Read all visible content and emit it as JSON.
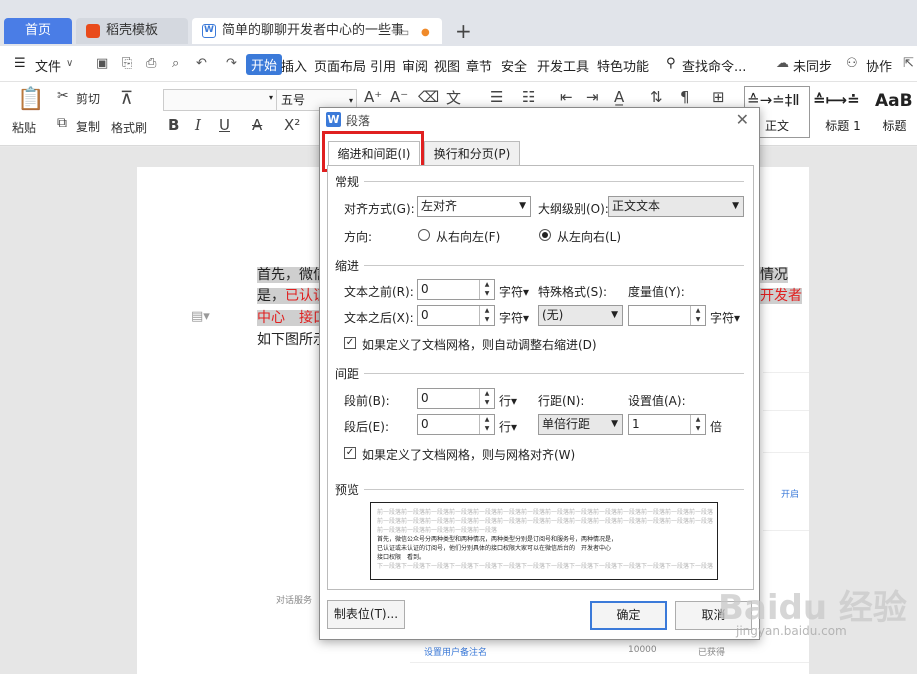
{
  "tabs": {
    "home": "首页",
    "template": "稻壳模板",
    "document": "简单的聊聊开发者中心的一些事",
    "new_tab": "+"
  },
  "menu": {
    "file": "文件",
    "items": [
      "开始",
      "插入",
      "页面布局",
      "引用",
      "审阅",
      "视图",
      "章节",
      "安全",
      "开发工具",
      "特色功能"
    ],
    "search": "查找命令...",
    "sync": "未同步",
    "collab": "协作"
  },
  "ribbon": {
    "paste": "粘贴",
    "cut": "剪切",
    "copy": "复制",
    "format_painter": "格式刷",
    "font_name": "",
    "font_size": "五号",
    "styles": [
      {
        "sample": "≙→≐‡Ⅱ",
        "name": "正文"
      },
      {
        "sample": "≙⟼≐",
        "name": "标题 1"
      },
      {
        "sample": "AaB",
        "name": "标题"
      }
    ]
  },
  "document": {
    "line1_start": "首先，微信",
    "line1_end": "情况",
    "line2_start": "是，",
    "line2_red": "已认证",
    "line2_end": "开发者",
    "line3_red": "中心　接口",
    "line4": "如下图所示",
    "bg_text": [
      "对话服务",
      "设置用户备注名",
      "10000",
      "已获得",
      "开启"
    ]
  },
  "dialog": {
    "title": "段落",
    "tabs": [
      "缩进和间距(I)",
      "换行和分页(P)"
    ],
    "general": {
      "section": "常规",
      "align_label": "对齐方式(G):",
      "align_value": "左对齐",
      "outline_label": "大纲级别(O):",
      "outline_value": "正文文本",
      "direction_label": "方向:",
      "rtl": "从右向左(F)",
      "ltr": "从左向右(L)"
    },
    "indent": {
      "section": "缩进",
      "before_label": "文本之前(R):",
      "before_value": "0",
      "after_label": "文本之后(X):",
      "after_value": "0",
      "unit": "字符▾",
      "special_label": "特殊格式(S):",
      "special_value": "(无)",
      "measure_label": "度量值(Y):",
      "measure_value": "",
      "grid_check": "如果定义了文档网格，则自动调整右缩进(D)"
    },
    "spacing": {
      "section": "间距",
      "before_label": "段前(B):",
      "before_value": "0",
      "after_label": "段后(E):",
      "after_value": "0",
      "unit": "行▾",
      "line_label": "行距(N):",
      "line_value": "单倍行距",
      "setting_label": "设置值(A):",
      "setting_value": "1",
      "setting_unit": "倍",
      "grid_check": "如果定义了文档网格，则与网格对齐(W)"
    },
    "preview": {
      "section": "预览",
      "lines_gray": [
        "前一段落前一段落前一段落前一段落前一段落前一段落前一段落前一段落前一段落前一段落前一段落前一段落前一段落前一段落",
        "前一段落前一段落前一段落前一段落前一段落前一段落前一段落前一段落前一段落前一段落前一段落前一段落前一段落前一段落",
        "前一段落前一段落前一段落前一段落前一段落"
      ],
      "lines_black": [
        "首先，微信公众号分两种类型和两种情况，两种类型分别是订阅号和服务号，两种情况是，",
        "已认证或未认证的订阅号，他们分别具体的接口权限大家可以在微信后台的　开发者中心",
        "接口权限　看到。"
      ],
      "lines_after": [
        "下一段落下一段落下一段落下一段落下一段落下一段落下一段落下一段落下一段落下一段落下一段落下一段落下一段落下一段落"
      ]
    },
    "tab_stops_button": "制表位(T)...",
    "ok_button": "确定",
    "cancel_button": "取消"
  },
  "watermark": {
    "brand": "Baidu 经验",
    "url": "jingyan.baidu.com"
  }
}
